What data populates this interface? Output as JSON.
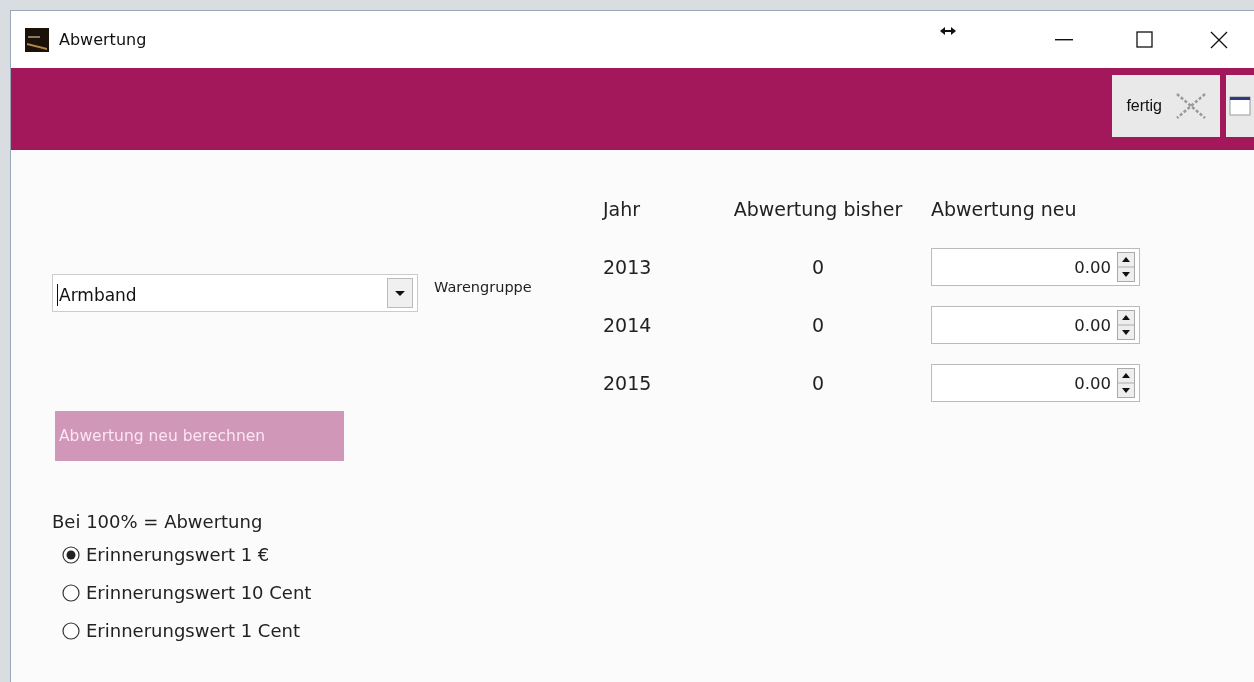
{
  "window": {
    "title": "Abwertung"
  },
  "toolbar": {
    "done_button": "fertig"
  },
  "product_group": {
    "value": "Armband",
    "label": "Warengruppe"
  },
  "recalculate_button": {
    "label": "Abwertung neu berechnen",
    "disabled": true
  },
  "rule": "Bei 100% = Abwertung",
  "options": [
    {
      "label": "Erinnerungswert 1 €",
      "selected": true
    },
    {
      "label": "Erinnerungswert 10 Cent",
      "selected": false
    },
    {
      "label": "Erinnerungswert 1 Cent",
      "selected": false
    }
  ],
  "table": {
    "columns": [
      "Jahr",
      "Abwertung bisher",
      "Abwertung neu"
    ],
    "rows": [
      {
        "year": "2013",
        "previous": "0",
        "new": "0.00"
      },
      {
        "year": "2014",
        "previous": "0",
        "new": "0.00"
      },
      {
        "year": "2015",
        "previous": "0",
        "new": "0.00"
      }
    ]
  }
}
